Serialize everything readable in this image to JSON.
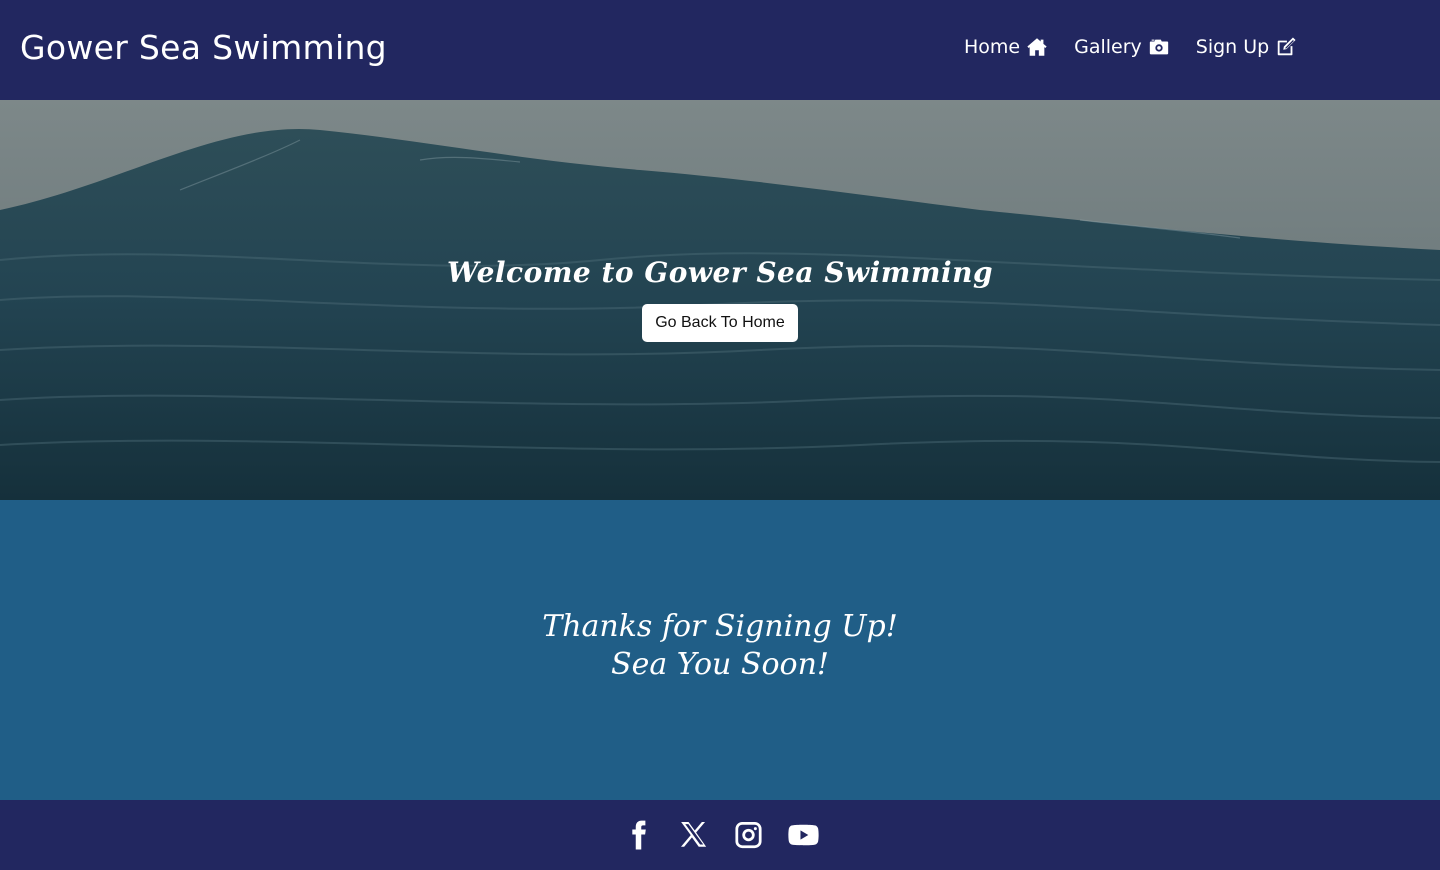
{
  "brand": {
    "title": "Gower Sea Swimming"
  },
  "nav": {
    "items": [
      {
        "label": "Home",
        "icon": "home-icon"
      },
      {
        "label": "Gallery",
        "icon": "camera-icon"
      },
      {
        "label": "Sign Up",
        "icon": "edit-icon"
      }
    ]
  },
  "hero": {
    "title": "Welcome to Gower Sea Swimming",
    "button_label": "Go Back To Home"
  },
  "thanks": {
    "line1": "Thanks for Signing Up!",
    "line2": "Sea You Soon!"
  },
  "footer": {
    "socials": [
      "facebook-icon",
      "x-icon",
      "instagram-icon",
      "youtube-icon"
    ]
  },
  "colors": {
    "navy": "#222760",
    "section_blue": "#205e87",
    "text": "#ffffff"
  }
}
